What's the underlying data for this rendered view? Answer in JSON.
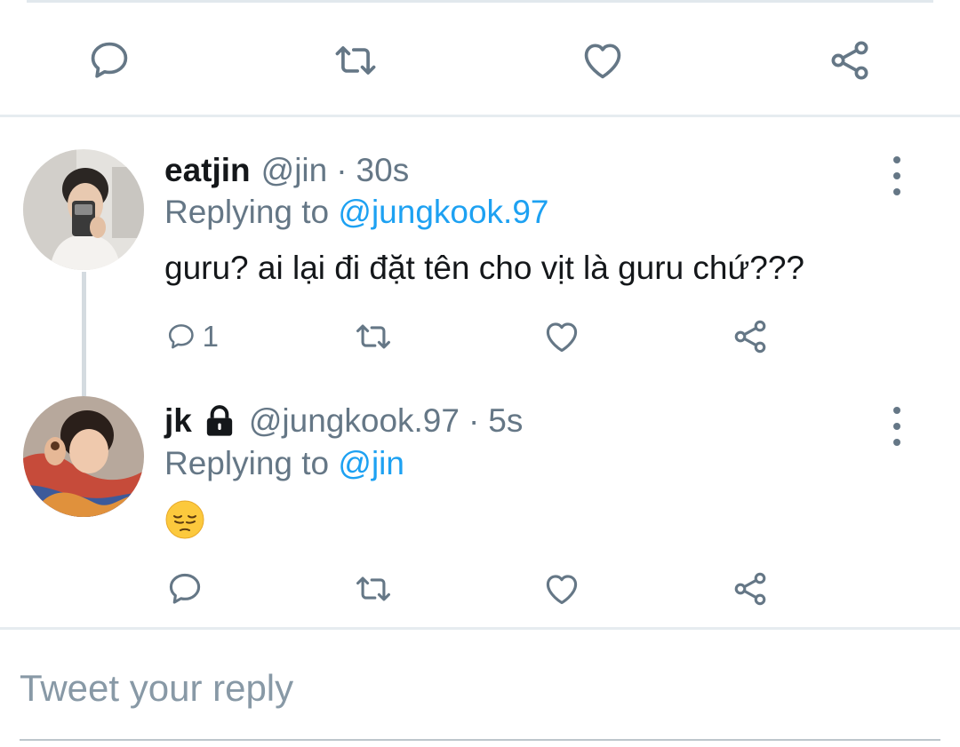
{
  "colors": {
    "text": "#14171a",
    "muted": "#657786",
    "link": "#1da1f2",
    "divider": "#e6ecf0"
  },
  "main_actions": {
    "icons": [
      "reply-icon",
      "retweet-icon",
      "like-icon",
      "share-icon"
    ]
  },
  "tweets": [
    {
      "name": "eatjin",
      "handle": "@jin",
      "separator": "·",
      "time": "30s",
      "replying_prefix": "Replying to",
      "replying_to": "@jungkook.97",
      "text": "guru? ai lại đi đặt tên cho vịt là guru chứ???",
      "reply_count": "1",
      "locked": false
    },
    {
      "name": "jk",
      "handle": "@jungkook.97",
      "separator": "·",
      "time": "5s",
      "replying_prefix": "Replying to",
      "replying_to": "@jin",
      "emoji": "pensive-face",
      "reply_count": "",
      "locked": true
    }
  ],
  "reply_input": {
    "placeholder": "Tweet your reply",
    "value": ""
  }
}
